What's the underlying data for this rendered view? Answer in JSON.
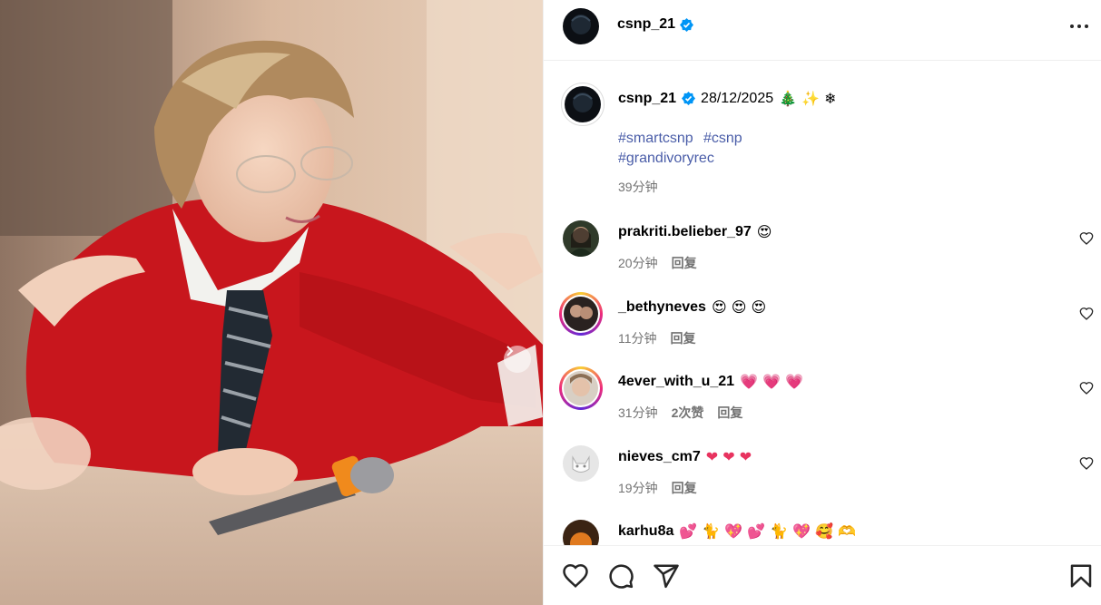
{
  "post": {
    "author": "csnp_21",
    "verified": true,
    "caption": {
      "date": "28/12/2025",
      "emojis": "🎄 ✨ ❄",
      "hashtags": [
        "#smartcsnp",
        "#csnp",
        "#grandivoryrec"
      ],
      "time": "39分钟"
    }
  },
  "comments": [
    {
      "user": "prakriti.belieber_97",
      "text": "😍",
      "time": "20分钟",
      "likes": "",
      "reply": "回复",
      "story_ring": false
    },
    {
      "user": "_bethyneves",
      "text": "😍 😍 😍",
      "time": "11分钟",
      "likes": "",
      "reply": "回复",
      "story_ring": true
    },
    {
      "user": "4ever_with_u_21",
      "text": "💗 💗 💗",
      "time": "31分钟",
      "likes": "2次赞",
      "reply": "回复",
      "story_ring": true
    },
    {
      "user": "nieves_cm7",
      "text": "❤ ❤ ❤",
      "time": "19分钟",
      "likes": "",
      "reply": "回复",
      "story_ring": false
    },
    {
      "user": "karhu8a",
      "text": "💕 🐈 💖 💕 🐈 💖 🥰 🫶",
      "time": "",
      "likes": "",
      "reply": "",
      "story_ring": false
    }
  ],
  "icons": {
    "header": [
      "more-options-icon"
    ],
    "actions": [
      "heart-icon",
      "comment-icon",
      "share-icon",
      "bookmark-icon"
    ],
    "media": [
      "chevron-right-icon"
    ]
  },
  "colors": {
    "verified": "#0095f6",
    "hashtag": "#4a5da8",
    "muted": "#737373",
    "heart_emoji": "#e8335f"
  }
}
